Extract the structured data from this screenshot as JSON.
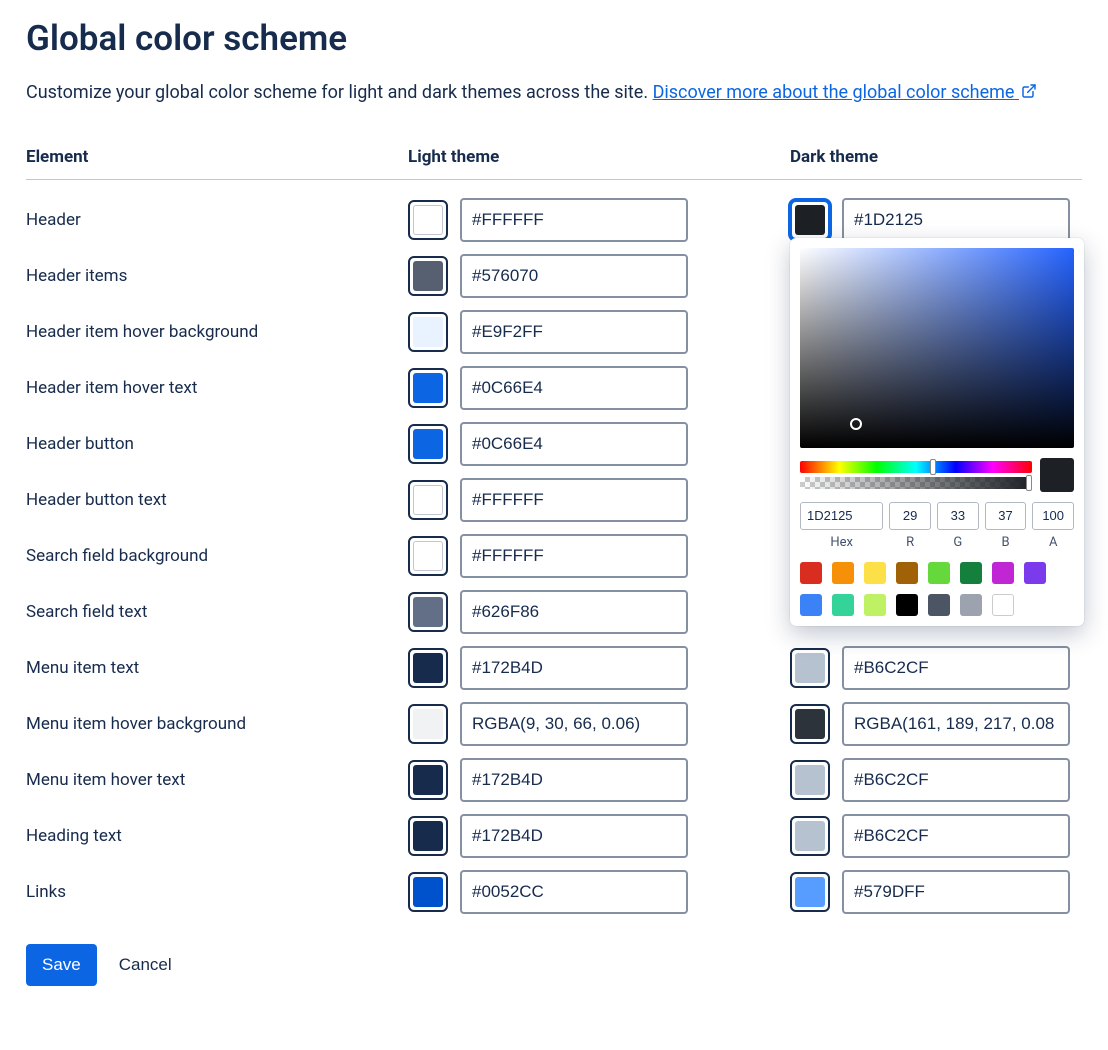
{
  "title": "Global color scheme",
  "description_text": "Customize your global color scheme for light and dark themes across the site. ",
  "link_text": "Discover more about the global color scheme",
  "columns": {
    "element": "Element",
    "light": "Light theme",
    "dark": "Dark theme"
  },
  "rows": [
    {
      "label": "Header",
      "light_hex": "#FFFFFF",
      "light_swatch": "#FFFFFF",
      "dark_hex": "#1D2125",
      "dark_swatch": "#1D2125",
      "dark_active": true
    },
    {
      "label": "Header items",
      "light_hex": "#576070",
      "light_swatch": "#576070",
      "dark_hex": "",
      "dark_swatch": ""
    },
    {
      "label": "Header item hover background",
      "light_hex": "#E9F2FF",
      "light_swatch": "#E9F2FF",
      "dark_hex": "",
      "dark_swatch": ""
    },
    {
      "label": "Header item hover text",
      "light_hex": "#0C66E4",
      "light_swatch": "#0C66E4",
      "dark_hex": "",
      "dark_swatch": ""
    },
    {
      "label": "Header button",
      "light_hex": "#0C66E4",
      "light_swatch": "#0C66E4",
      "dark_hex": "",
      "dark_swatch": ""
    },
    {
      "label": "Header button text",
      "light_hex": "#FFFFFF",
      "light_swatch": "#FFFFFF",
      "dark_hex": "",
      "dark_swatch": ""
    },
    {
      "label": "Search field background",
      "light_hex": "#FFFFFF",
      "light_swatch": "#FFFFFF",
      "dark_hex": "",
      "dark_swatch": ""
    },
    {
      "label": "Search field text",
      "light_hex": "#626F86",
      "light_swatch": "#626F86",
      "dark_hex": "",
      "dark_swatch": ""
    },
    {
      "label": "Menu item text",
      "light_hex": "#172B4D",
      "light_swatch": "#172B4D",
      "dark_hex": "#B6C2CF",
      "dark_swatch": "#B6C2CF"
    },
    {
      "label": "Menu item hover background",
      "light_hex": "RGBA(9, 30, 66, 0.06)",
      "light_swatch": "rgba(9,30,66,0.06)",
      "dark_hex": "RGBA(161, 189, 217, 0.08",
      "dark_swatch": "#2C333A"
    },
    {
      "label": "Menu item hover text",
      "light_hex": "#172B4D",
      "light_swatch": "#172B4D",
      "dark_hex": "#B6C2CF",
      "dark_swatch": "#B6C2CF"
    },
    {
      "label": "Heading text",
      "light_hex": "#172B4D",
      "light_swatch": "#172B4D",
      "dark_hex": "#B6C2CF",
      "dark_swatch": "#B6C2CF"
    },
    {
      "label": "Links",
      "light_hex": "#0052CC",
      "light_swatch": "#0052CC",
      "dark_hex": "#579DFF",
      "dark_swatch": "#579DFF"
    }
  ],
  "actions": {
    "save": "Save",
    "cancel": "Cancel"
  },
  "picker": {
    "hex": "1D2125",
    "r": "29",
    "g": "33",
    "b": "37",
    "a": "100",
    "labels": {
      "hex": "Hex",
      "r": "R",
      "g": "G",
      "b": "B",
      "a": "A"
    },
    "presets": [
      "#D92D20",
      "#F79009",
      "#FDE047",
      "#A16207",
      "#65D83C",
      "#15803D",
      "#C026D3",
      "#7C3AED",
      "#3B82F6",
      "#34D399",
      "#BEF264",
      "#000000",
      "#4B5563",
      "#9CA3AF",
      "#FFFFFF"
    ]
  }
}
